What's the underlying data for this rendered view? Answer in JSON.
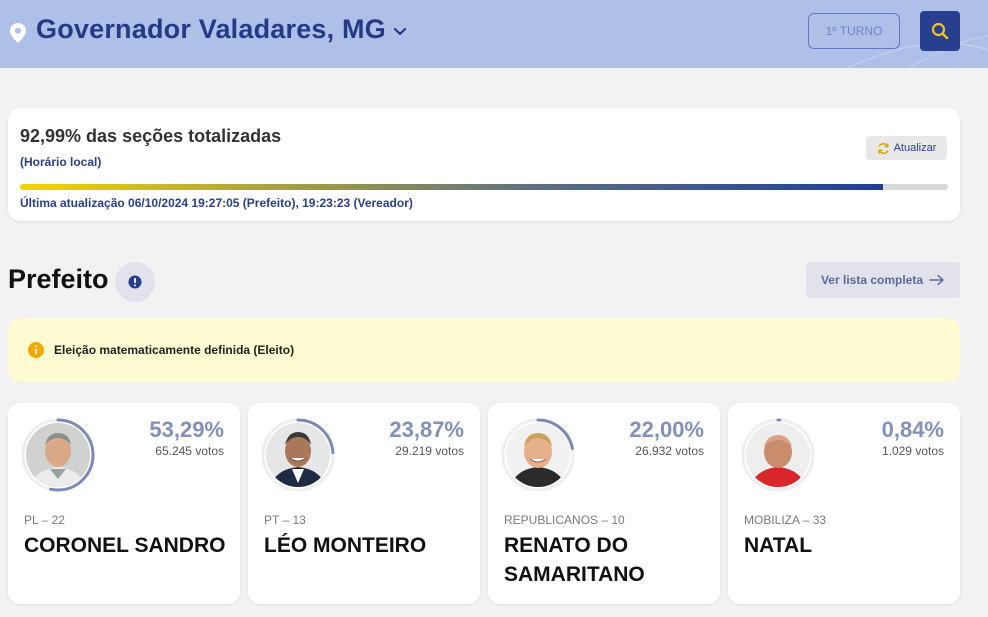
{
  "header": {
    "city": "Governador Valadares, MG",
    "turno_label": "1º TURNO",
    "icons": {
      "location": "location-pin-icon",
      "chevron": "chevron-down-icon",
      "search": "search-icon"
    }
  },
  "status": {
    "title": "92,99% das seções totalizadas",
    "local_time_label": "(Horário local)",
    "refresh_label": "Atualizar",
    "progress": 0.9299,
    "last_update": "Última atualização 06/10/2024 19:27:05 (Prefeito), 19:23:23 (Vereador)"
  },
  "section": {
    "title": "Prefeito",
    "full_list_label": "Ver lista completa"
  },
  "notice": {
    "text": "Eleição matematicamente definida (Eleito)"
  },
  "candidates": [
    {
      "percent": "53,29%",
      "votes": "65.245 votos",
      "party": "PL – 22",
      "name": "CORONEL SANDRO",
      "share": 0.5329
    },
    {
      "percent": "23,87%",
      "votes": "29.219 votos",
      "party": "PT – 13",
      "name": "LÉO MONTEIRO",
      "share": 0.2387
    },
    {
      "percent": "22,00%",
      "votes": "26.932 votos",
      "party": "REPUBLICANOS – 10",
      "name": "RENATO DO SAMARITANO",
      "share": 0.22
    },
    {
      "percent": "0,84%",
      "votes": "1.029 votos",
      "party": "MOBILIZA – 33",
      "name": "NATAL",
      "share": 0.0084
    }
  ],
  "colors": {
    "header_bg": "#aebfe8",
    "brand_blue": "#283e8e",
    "ring": "#7d8ab8",
    "notice_bg": "#fefad1"
  }
}
